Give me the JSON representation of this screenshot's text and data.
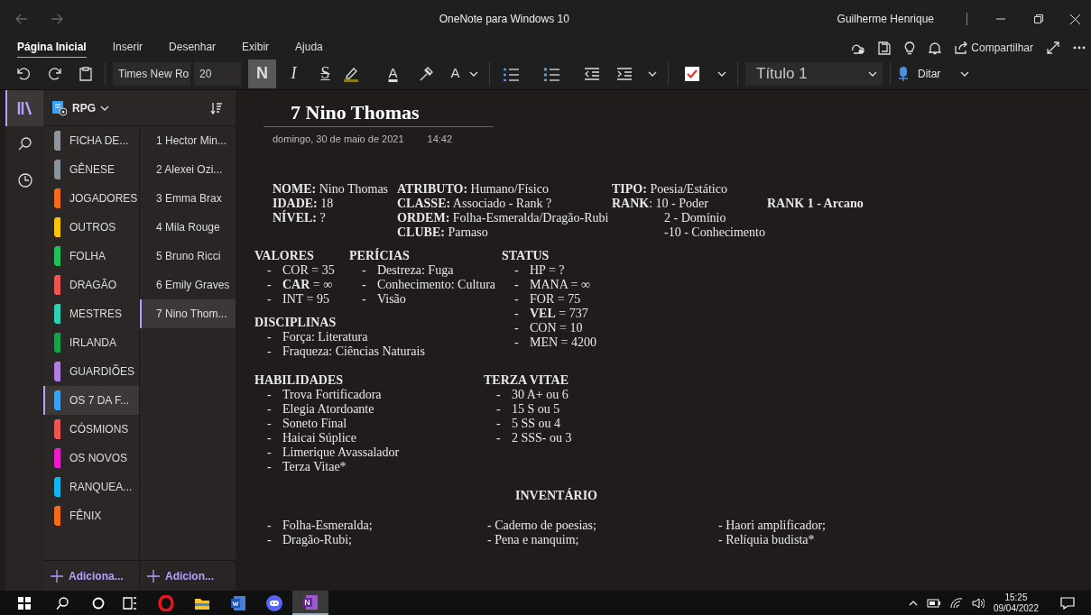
{
  "title_bar": {
    "title": "OneNote para Windows 10",
    "user": "Guilherme Henrique"
  },
  "ribbon_tabs": [
    {
      "label": "Página Inicial",
      "selected": true
    },
    {
      "label": "Inserir",
      "selected": false
    },
    {
      "label": "Desenhar",
      "selected": false
    },
    {
      "label": "Exibir",
      "selected": false
    },
    {
      "label": "Ajuda",
      "selected": false
    }
  ],
  "share": {
    "label": "Compartilhar"
  },
  "toolbar": {
    "font": "Times New Ro",
    "size": "20",
    "format_buttons": [
      {
        "kind": "bold",
        "label": "N",
        "active": true
      },
      {
        "kind": "italic",
        "label": "I",
        "active": false
      },
      {
        "kind": "strike",
        "label": "S",
        "active": false
      }
    ],
    "font_color": {
      "label": "A"
    },
    "clear_format": {
      "label": "A"
    },
    "tag_checked": true,
    "style": "Título 1",
    "dictate": "Ditar"
  },
  "nav": [
    {
      "kind": "notebooks",
      "selected": true
    },
    {
      "kind": "search",
      "selected": false
    },
    {
      "kind": "recent",
      "selected": false
    }
  ],
  "notebook": {
    "name": "RPG"
  },
  "sections": [
    {
      "label": "FICHA DE...",
      "color": "#8e959b",
      "selected": false
    },
    {
      "label": "GÊNESE",
      "color": "#8a9399",
      "selected": false
    },
    {
      "label": "JOGADORES",
      "color": "#f36a1c",
      "selected": false
    },
    {
      "label": "OUTROS",
      "color": "#f9c40f",
      "selected": false
    },
    {
      "label": "FOLHA",
      "color": "#20c05a",
      "selected": false
    },
    {
      "label": "DRAGÃO",
      "color": "#ee5454",
      "selected": false
    },
    {
      "label": "MESTRES",
      "color": "#2fd1b4",
      "selected": false
    },
    {
      "label": "IRLANDA",
      "color": "#18a14a",
      "selected": false
    },
    {
      "label": "GUARDIÕES",
      "color": "#b27ce0",
      "selected": false
    },
    {
      "label": "OS 7 DA F...",
      "color": "#3aa0f0",
      "selected": true
    },
    {
      "label": "CÓSMIONS",
      "color": "#ee5454",
      "selected": false
    },
    {
      "label": "OS NOVOS",
      "color": "#ef1ac9",
      "selected": false
    },
    {
      "label": "RANQUEA...",
      "color": "#15b4ef",
      "selected": false
    },
    {
      "label": "FÊNIX",
      "color": "#f36a1c",
      "selected": false
    }
  ],
  "pages": [
    {
      "label": "1 Hector Min...",
      "selected": false
    },
    {
      "label": "2 Alexei Ozi...",
      "selected": false
    },
    {
      "label": "3 Emma Brax",
      "selected": false
    },
    {
      "label": "4 Mila Rouge",
      "selected": false
    },
    {
      "label": "5 Bruno Ricci",
      "selected": false
    },
    {
      "label": "6 Emily Graves",
      "selected": false
    },
    {
      "label": "7 Nino Thom...",
      "selected": true
    }
  ],
  "add_section": {
    "label": "Adiciona..."
  },
  "add_page": {
    "label": "Adicion..."
  },
  "note": {
    "title": "7 Nino Thomas",
    "date": "domingo, 30 de maio de 2021",
    "time": "14:42",
    "info_rows": [
      [
        "**NOME:** Nino Thomas",
        "**ATRIBUTO:** Humano/Físico",
        "**TIPO:** Poesia/Estático",
        ""
      ],
      [
        "**IDADE:** 18",
        "**CLASSE:** Associado - Rank ?",
        "**RANK**: 10 - Poder",
        "**RANK 1 - Arcano**"
      ],
      [
        "**NÍVEL:** ?",
        "**ORDEM:** Folha-Esmeralda/Dragão-Rubi",
        "2 - Domínio",
        ""
      ],
      [
        "",
        "**CLUBE:** Parnaso",
        "-10 - Conhecimento",
        ""
      ]
    ],
    "sections": [
      {
        "heading": "VALORES",
        "items": [
          {
            "bullet": "-",
            "text": "COR = 35"
          },
          {
            "bullet": "-",
            "text": "**CAR** = ∞"
          },
          {
            "bullet": "-",
            "text": "INT = 95"
          }
        ]
      },
      {
        "heading": "PERÍCIAS",
        "items": [
          {
            "bullet": "-",
            "text": "Destreza: Fuga"
          },
          {
            "bullet": "-",
            "text": "Conhecimento: Cultura"
          },
          {
            "bullet": "-",
            "text": "Visão"
          }
        ]
      },
      {
        "heading": "STATUS",
        "items": [
          {
            "bullet": "-",
            "text": "HP = ?"
          },
          {
            "bullet": "-",
            "text": "MANA = ∞"
          },
          {
            "bullet": "-",
            "text": "FOR = 75"
          },
          {
            "bullet": "-",
            "text": "**VEL** = 737"
          },
          {
            "bullet": "-",
            "text": "CON = 10"
          },
          {
            "bullet": "-",
            "text": "MEN = 4200"
          }
        ]
      },
      {
        "heading": "DISCIPLINAS",
        "items": [
          {
            "bullet": "-",
            "text": "Força: Literatura"
          },
          {
            "bullet": "-",
            "text": "Fraqueza: Ciências Naturais"
          }
        ]
      },
      {
        "heading": "HABILIDADES",
        "items": [
          {
            "bullet": "-",
            "text": "Trova Fortificadora"
          },
          {
            "bullet": "-",
            "text": "Elegia Atordoante"
          },
          {
            "bullet": "-",
            "text": "Soneto Final"
          },
          {
            "bullet": "-",
            "text": "Haicai Súplice"
          },
          {
            "bullet": "-",
            "text": "Limerique Avassalador"
          },
          {
            "bullet": "-",
            "text": "Terza Vitae*"
          }
        ]
      },
      {
        "heading": "TERZA VITAE",
        "items": [
          {
            "bullet": "-",
            "text": "30 A+ ou 6"
          },
          {
            "bullet": "-",
            "text": "15 S ou 5"
          },
          {
            "bullet": "-",
            "text": "5 SS ou 4"
          },
          {
            "bullet": "-",
            "text": "2 SSS- ou 3"
          }
        ]
      }
    ],
    "inventory": {
      "heading": "INVENTÁRIO",
      "columns": [
        [
          {
            "bullet": "-",
            "text": "Folha-Esmeralda;"
          },
          {
            "bullet": "-",
            "text": "Dragão-Rubi;"
          }
        ],
        [
          {
            "text": "- Caderno de poesias;"
          },
          {
            "text": "- Pena e nanquim;"
          }
        ],
        [
          {
            "text": "- Haori amplificador;"
          },
          {
            "text": "- Relíquia budista*"
          }
        ]
      ]
    }
  },
  "taskbar": {
    "apps": [
      {
        "kind": "opera",
        "active": false
      },
      {
        "kind": "explorer",
        "active": false
      },
      {
        "kind": "word",
        "active": false
      },
      {
        "kind": "discord",
        "active": false
      },
      {
        "kind": "onenote",
        "active": true
      }
    ],
    "time": "15:25",
    "date": "09/04/2022"
  }
}
